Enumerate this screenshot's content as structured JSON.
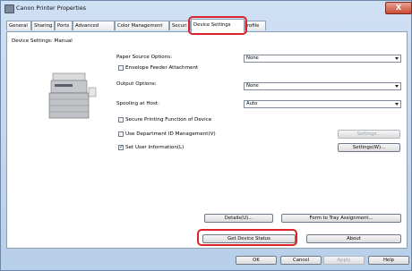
{
  "window": {
    "title": "Canon Printer Properties",
    "close_glyph": "X"
  },
  "tabs": [
    "General",
    "Sharing",
    "Ports",
    "Advanced",
    "Color Management",
    "Securi",
    "Device Settings",
    "rofile"
  ],
  "panel": {
    "header": "Device Settings: Manual",
    "paper_source_label": "Paper Source Options:",
    "paper_source_value": "None",
    "envelope_feeder_label": "Envelope Feeder Attachment",
    "output_label": "Output Options:",
    "output_value": "None",
    "spooling_label": "Spooling at Host:",
    "spooling_value": "Auto",
    "secure_print_label": "Secure Printing Function of Device",
    "dept_id_label": "Use Department ID Management(V)",
    "dept_settings_button": "Settings...",
    "user_info_label": "Set User Information(L)",
    "user_settings_button": "Settings(W)...",
    "details_button": "Details(U)...",
    "form_tray_button": "Form to Tray Assignment...",
    "get_status_button": "Get Device Status",
    "about_button": "About"
  },
  "footer": {
    "ok": "OK",
    "cancel": "Cancel",
    "apply": "Apply",
    "help": "Help"
  }
}
